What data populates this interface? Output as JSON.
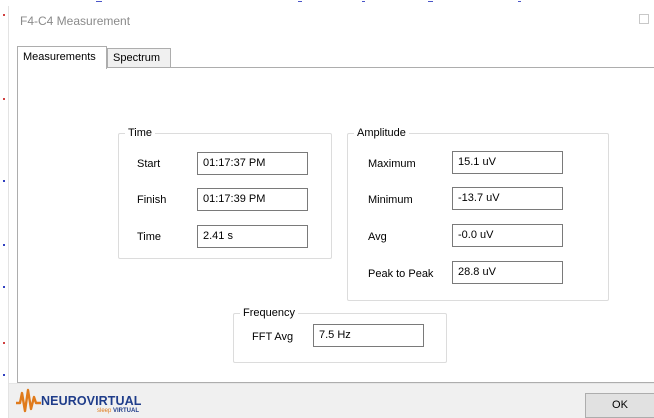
{
  "window": {
    "title": "F4-C4 Measurement"
  },
  "tabs": [
    {
      "label": "Measurements",
      "active": true
    },
    {
      "label": "Spectrum",
      "active": false
    }
  ],
  "time_group": {
    "legend": "Time",
    "fields": [
      {
        "label": "Start",
        "value": "01:17:37 PM"
      },
      {
        "label": "Finish",
        "value": "01:17:39 PM"
      },
      {
        "label": "Time",
        "value": "2.41 s"
      }
    ]
  },
  "amplitude_group": {
    "legend": "Amplitude",
    "fields": [
      {
        "label": "Maximum",
        "value": "15.1 uV"
      },
      {
        "label": "Minimum",
        "value": "-13.7 uV"
      },
      {
        "label": "Avg",
        "value": "-0.0 uV"
      },
      {
        "label": "Peak to Peak",
        "value": "28.8 uV"
      }
    ]
  },
  "frequency_group": {
    "legend": "Frequency",
    "fields": [
      {
        "label": "FFT Avg",
        "value": "7.5 Hz"
      }
    ]
  },
  "footer": {
    "logo_name": "NEUROVIRTUAL",
    "logo_tagline_a": "sleep",
    "logo_tagline_b": "VIRTUAL",
    "ok_label": "OK"
  },
  "colors": {
    "logo_blue": "#1f3d8a",
    "logo_orange": "#e07b1c",
    "title_gray": "#8a8a8a"
  }
}
